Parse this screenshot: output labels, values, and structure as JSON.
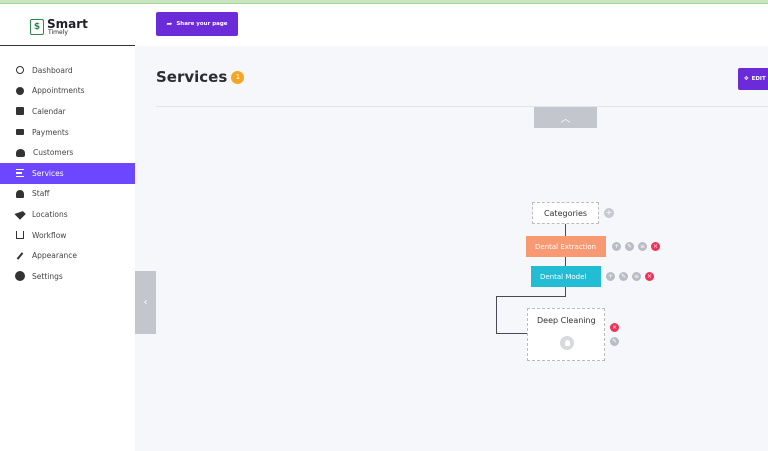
{
  "app": {
    "logo_main": "Smart",
    "logo_sub": "Timely",
    "logo_mark": "$"
  },
  "sidebar": {
    "items": [
      {
        "label": "Dashboard",
        "icon": "dashboard-icon"
      },
      {
        "label": "Appointments",
        "icon": "clock-icon"
      },
      {
        "label": "Calendar",
        "icon": "calendar-icon"
      },
      {
        "label": "Payments",
        "icon": "wallet-icon"
      },
      {
        "label": "Customers",
        "icon": "users-icon"
      },
      {
        "label": "Services",
        "icon": "list-icon",
        "active": true
      },
      {
        "label": "Staff",
        "icon": "user-icon"
      },
      {
        "label": "Locations",
        "icon": "location-arrow-icon"
      },
      {
        "label": "Workflow",
        "icon": "workflow-icon"
      },
      {
        "label": "Appearance",
        "icon": "brush-icon"
      },
      {
        "label": "Settings",
        "icon": "gear-icon"
      }
    ]
  },
  "header": {
    "share_label": "Share your page",
    "share_icon": "share-arrow-icon"
  },
  "page": {
    "title": "Services",
    "count": "1",
    "edit_label": "EDIT"
  },
  "tree": {
    "root_label": "Categories",
    "categories": [
      {
        "label": "Dental Extraction",
        "color": "#f79a74"
      },
      {
        "label": "Dental Model",
        "color": "#22bcd5"
      }
    ],
    "service": {
      "label": "Deep Cleaning"
    }
  },
  "colors": {
    "accent": "#6c47ff",
    "button": "#6c2bd9",
    "badge": "#f5a623",
    "delete": "#f0325b"
  }
}
